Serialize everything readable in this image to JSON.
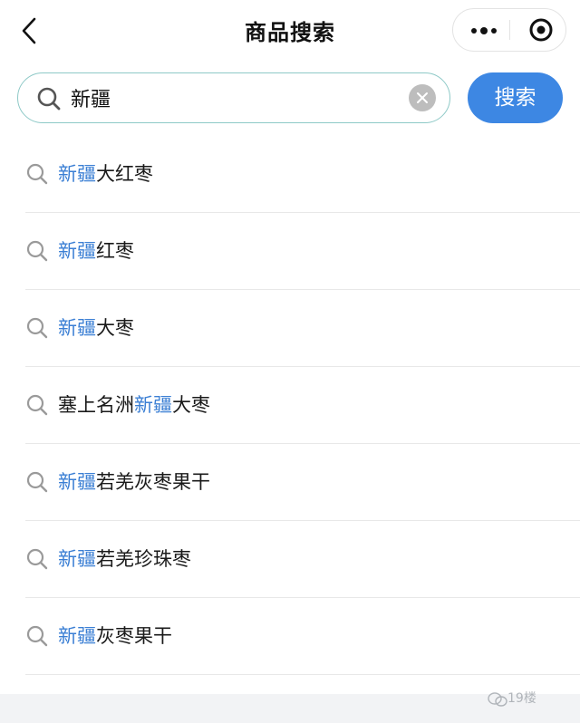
{
  "header": {
    "title": "商品搜索",
    "back_icon": "chevron-left-icon",
    "more_icon": "more-dots-icon",
    "close_icon": "target-circle-icon"
  },
  "search": {
    "query": "新疆",
    "search_icon": "search-icon",
    "clear_icon": "clear-icon",
    "button_label": "搜索",
    "accent_color": "#3d87e3",
    "border_color": "#8ec9c7",
    "caret_color": "#2cc07a"
  },
  "suggestions": [
    {
      "before": "",
      "highlight": "新疆",
      "after": "大红枣"
    },
    {
      "before": "",
      "highlight": "新疆",
      "after": "红枣"
    },
    {
      "before": "",
      "highlight": "新疆",
      "after": "大枣"
    },
    {
      "before": "塞上名洲",
      "highlight": "新疆",
      "after": "大枣"
    },
    {
      "before": "",
      "highlight": "新疆",
      "after": "若羌灰枣果干"
    },
    {
      "before": "",
      "highlight": "新疆",
      "after": "若羌珍珠枣"
    },
    {
      "before": "",
      "highlight": "新疆",
      "after": "灰枣果干"
    }
  ],
  "highlight_color": "#3b7fd4",
  "watermark": {
    "text": "19楼"
  }
}
